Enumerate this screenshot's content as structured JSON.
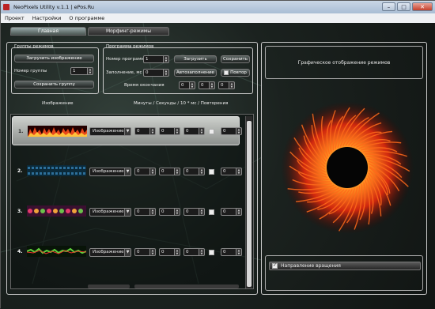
{
  "window": {
    "title": "NeoPixels Utility v.1.1 | ePos.Ru",
    "minimize": "–",
    "maximize": "□",
    "close": "✕"
  },
  "menu": [
    "Проект",
    "Настройки",
    "О программе"
  ],
  "tabs": [
    {
      "label": "Главная",
      "active": true
    },
    {
      "label": "Морфинг-режимы",
      "active": false
    }
  ],
  "groups_panel": {
    "title": "Группы режимов",
    "load_image_button": "Загрузить изображение",
    "group_number_label": "Номер группы",
    "group_number_value": "1",
    "save_group_button": "Сохранить группу"
  },
  "programs_panel": {
    "title": "Программа режимов",
    "program_number_label": "Номер программы",
    "program_number_value": "1",
    "load_button": "Загрузить",
    "save_button": "Сохранить",
    "fill_label": "Заполнение, мс",
    "fill_value": "0",
    "autofill_button": "Автозаполнение",
    "repeat_label": "Повтор",
    "end_time_label": "Время окончания",
    "end_time_values": [
      "0",
      "0",
      "0"
    ]
  },
  "list_headers": {
    "image": "Изображение",
    "timing": "Минуты / Секунды / 10 * мс / Повторения"
  },
  "rows": [
    {
      "num": "1.",
      "mode": "Изображение",
      "values": [
        "0",
        "0",
        "0",
        "0"
      ],
      "selected": true
    },
    {
      "num": "2.",
      "mode": "Изображение",
      "values": [
        "0",
        "0",
        "0",
        "0"
      ],
      "selected": false
    },
    {
      "num": "3.",
      "mode": "Изображение",
      "values": [
        "0",
        "0",
        "0",
        "0"
      ],
      "selected": false
    },
    {
      "num": "4.",
      "mode": "Изображение",
      "values": [
        "0",
        "0",
        "0",
        "0"
      ],
      "selected": false
    }
  ],
  "preview": {
    "title": "Графическое отображение режимов",
    "rotation_label": "Направление вращения",
    "rotation_checked": true
  }
}
